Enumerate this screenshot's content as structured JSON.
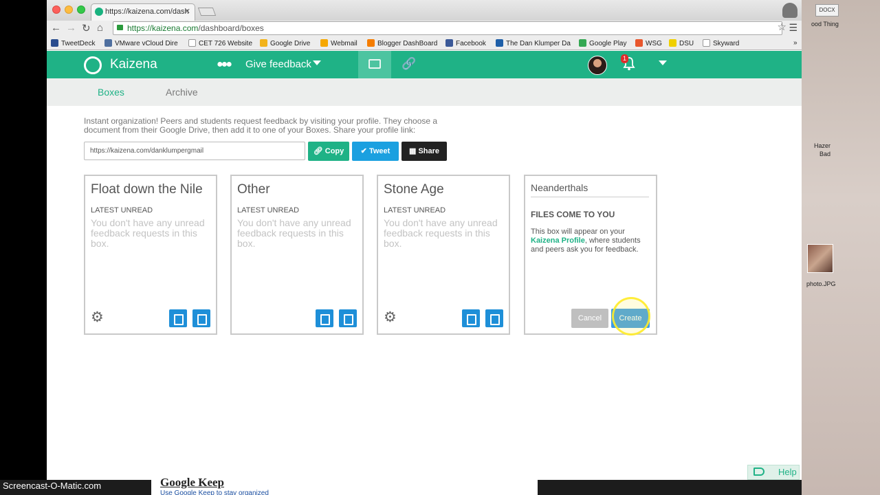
{
  "browser": {
    "tab_title": "https://kaizena.com/dash",
    "url_host": "https://kaizena.com",
    "url_path": "/dashboard/boxes",
    "bookmarks": [
      {
        "label": "TweetDeck",
        "color": "#2a4d8f"
      },
      {
        "label": "VMware vCloud Dire",
        "color": "#4f6f9f"
      },
      {
        "label": "CET 726 Website",
        "color": "#dddddd"
      },
      {
        "label": "Google Drive",
        "color": "#f2b31b"
      },
      {
        "label": "Webmail",
        "color": "#f6a800"
      },
      {
        "label": "Blogger DashBoard",
        "color": "#f57d00"
      },
      {
        "label": "Facebook",
        "color": "#3b5998"
      },
      {
        "label": "The Dan Klumper Da",
        "color": "#1e5fa8"
      },
      {
        "label": "Google Play",
        "color": "#34a853"
      },
      {
        "label": "WSG",
        "color": "#e8572d"
      },
      {
        "label": "DSU",
        "color": "#f0d000"
      },
      {
        "label": "Skyward",
        "color": "#dddddd"
      }
    ],
    "more_bookmarks": "»"
  },
  "app": {
    "logo_text": "Kaizena",
    "give_feedback": "Give feedback",
    "notification_count": "1",
    "accent_color": "#1fb286"
  },
  "subnav": {
    "boxes": "Boxes",
    "archive": "Archive"
  },
  "intro": {
    "text": "Instant organization! Peers and students request feedback by visiting your profile. They choose a document from their Google Drive, then add it to one of your Boxes. Share your profile link:",
    "profile_url": "https://kaizena.com/danklumpergmail",
    "copy": "Copy",
    "tweet": "Tweet",
    "share": "Share"
  },
  "boxes": [
    {
      "title": "Float down the Nile",
      "latest": "LATEST UNREAD",
      "empty": "You don't have any unread feedback requests in this box."
    },
    {
      "title": "Other",
      "latest": "LATEST UNREAD",
      "empty": "You don't have any unread feedback requests in this box."
    },
    {
      "title": "Stone Age",
      "latest": "LATEST UNREAD",
      "empty": "You don't have any unread feedback requests in this box."
    }
  ],
  "new_box": {
    "name_value": "Neanderthals",
    "heading": "FILES COME TO YOU",
    "desc_before": "This box will appear on your ",
    "desc_link": "Kaizena Profile",
    "desc_after": ", where students and peers ask you for feedback.",
    "cancel": "Cancel",
    "create": "Create"
  },
  "help": "Help",
  "overlay": {
    "watermark": "Screencast-O-Matic.com",
    "bg_title": "Google Keep",
    "bg_sub": "Use Google Keep to stay organized"
  },
  "desktop": {
    "docx": "DOCX",
    "file1": "ood Thing",
    "file2a": "Hazer",
    "file2b": "Bad",
    "photo": "photo.JPG"
  }
}
